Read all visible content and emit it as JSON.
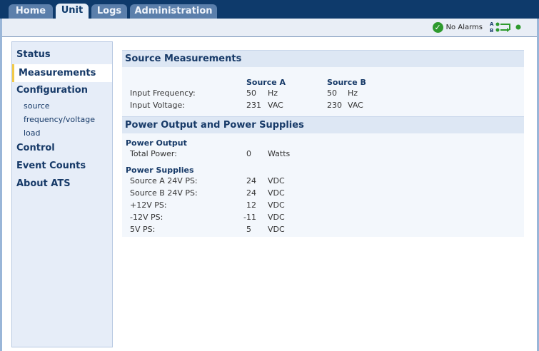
{
  "tabs": [
    {
      "label": "Home",
      "active": false
    },
    {
      "label": "Unit",
      "active": true
    },
    {
      "label": "Logs",
      "active": false
    },
    {
      "label": "Administration",
      "active": false
    }
  ],
  "status": {
    "alarm_text": "No Alarms",
    "indicator_letters": [
      "A",
      "B"
    ]
  },
  "sidebar": {
    "items": [
      {
        "label": "Status"
      },
      {
        "label": "Measurements",
        "active": true
      },
      {
        "label": "Configuration"
      },
      {
        "label": "Control"
      },
      {
        "label": "Event Counts"
      },
      {
        "label": "About ATS"
      }
    ],
    "config_sub": [
      "source",
      "frequency/voltage",
      "load"
    ]
  },
  "source_measurements": {
    "title": "Source Measurements",
    "col_a": "Source A",
    "col_b": "Source B",
    "rows": [
      {
        "label": "Input Frequency:",
        "a": "50",
        "a_unit": "Hz",
        "b": "50",
        "b_unit": "Hz"
      },
      {
        "label": "Input Voltage:",
        "a": "231",
        "a_unit": "VAC",
        "b": "230",
        "b_unit": "VAC"
      }
    ]
  },
  "power": {
    "title": "Power Output and Power Supplies",
    "output_title": "Power Output",
    "total_power": {
      "label": "Total Power:",
      "value": "0",
      "unit": "Watts"
    },
    "supplies_title": "Power Supplies",
    "supplies": [
      {
        "label": "Source A 24V PS:",
        "value": "24",
        "unit": "VDC"
      },
      {
        "label": "Source B 24V PS:",
        "value": "24",
        "unit": "VDC"
      },
      {
        "label": "+12V PS:",
        "value": "12",
        "unit": "VDC"
      },
      {
        "label": "-12V PS:",
        "value": "-11",
        "unit": "VDC"
      },
      {
        "label": "5V PS:",
        "value": "5",
        "unit": "VDC"
      }
    ]
  },
  "colors": {
    "nav_dark": "#0e3a6b",
    "tab": "#5b7fab",
    "accent": "#f0c94a",
    "ok_green": "#2e9a2e"
  }
}
